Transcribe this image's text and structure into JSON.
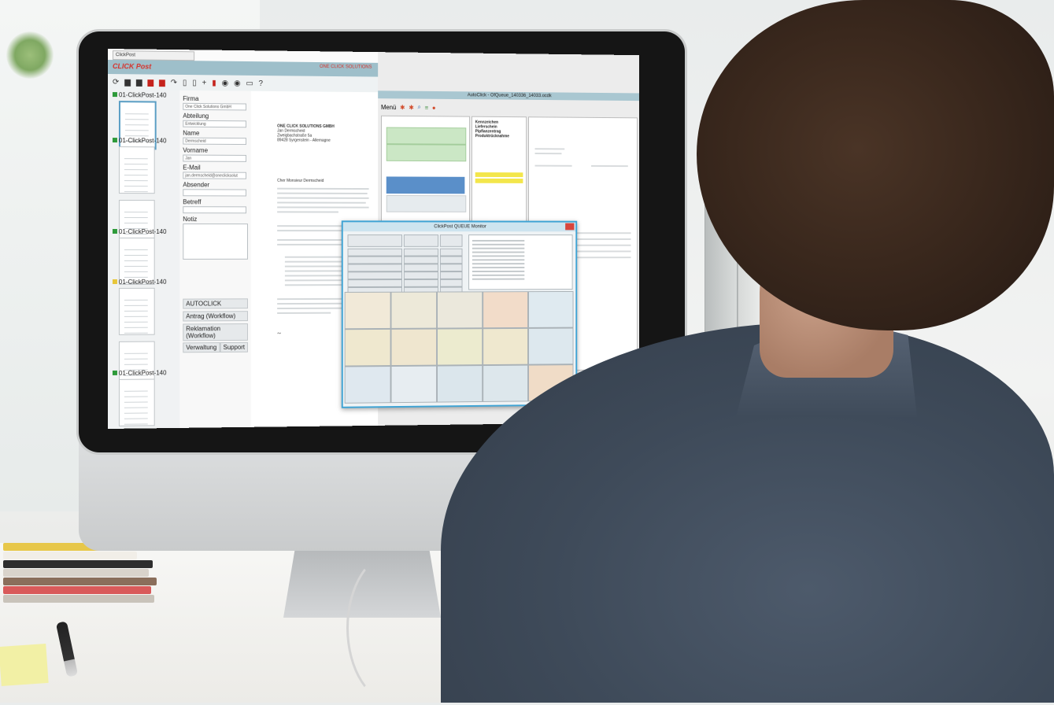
{
  "app": {
    "tab_title": "ClickPost",
    "brand": "CLICK Post",
    "brand_right": "ONE CLICK SOLUTIONS",
    "thumbnails": [
      {
        "label": "01-ClickPost-140"
      },
      {
        "label": "01-ClickPost-140"
      },
      {
        "label": "01-ClickPost-140"
      },
      {
        "label": "01-ClickPost-140"
      },
      {
        "label": "01-ClickPost-140"
      }
    ],
    "form": {
      "firma_label": "Firma",
      "firma_value": "One Click Solutions GmbH",
      "abteilung_label": "Abteilung",
      "abteilung_value": "Entwicklung",
      "name_label": "Name",
      "name_value": "Dermscheid",
      "vorname_label": "Vorname",
      "vorname_value": "Jan",
      "email_label": "E-Mail",
      "email_value": "jan.dermscheid@oneclicksolut",
      "absender_label": "Absender",
      "betreff_label": "Betreff",
      "notiz_label": "Notiz"
    },
    "buttons": {
      "autoclick": "AUTOCLICK",
      "antrag": "Antrag (Workflow)",
      "reklamation": "Reklamation (Workflow)",
      "verwaltung": "Verwaltung",
      "support": "Support"
    },
    "letter": {
      "line1": "ONE CLICK SOLUTIONS GMBH",
      "line2": "Jan Dermscheid",
      "line3": "Zweigbachstraße 5a",
      "line4": "89428 Syrgenstein - Allemagne",
      "salutation": "Cher Monsieur Dermscheid"
    }
  },
  "app2": {
    "title": "AutoClick - OfQueue_140336_14033.ocdk",
    "menu_label": "Menü",
    "menu_items": [
      "Kennzeichen",
      "Lieferschein",
      "Pipflanzentrag",
      "Produktrücknahme"
    ],
    "popup_title": "ClickPost QUEUE Monitor"
  }
}
